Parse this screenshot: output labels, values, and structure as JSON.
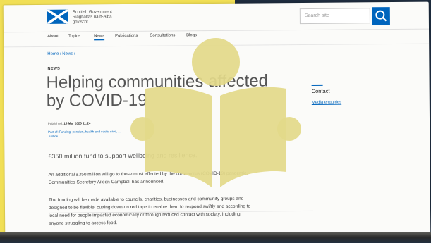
{
  "site": {
    "logo_lines": [
      "Scottish Government",
      "Riaghaltas na h-Alba",
      "gov.scot"
    ]
  },
  "search": {
    "placeholder": "Search site"
  },
  "nav": [
    {
      "label": "About",
      "active": false
    },
    {
      "label": "Topics",
      "active": false
    },
    {
      "label": "News",
      "active": true
    },
    {
      "label": "Publications",
      "active": false
    },
    {
      "label": "Consultations",
      "active": false
    },
    {
      "label": "Blogs",
      "active": false
    }
  ],
  "breadcrumb": "Home / News /",
  "article": {
    "label": "NEWS",
    "title": "Helping communities affected by COVID-19",
    "published_label": "Published:",
    "published": "18 Mar 2020 11:24",
    "part_of": "Part of: Funding, pension, health and social care, ...",
    "part_of_cont": "Justice",
    "summary": "£350 million fund to support wellbeing and resilience.",
    "paragraphs": [
      "An additional £350 million will go to those most affected by the coronavirus (COVID-19) pandemic, Communities Secretary Aileen Campbell has announced.",
      "The funding will be made available to councils, charities, businesses and community groups and designed to be flexible, cutting down on red tape to enable them to respond swiftly and according to local need for people impacted economically or through reduced contact with society, including anyone struggling to access food."
    ]
  },
  "sidebar": {
    "heading": "Contact",
    "link": "Media enquiries"
  },
  "colors": {
    "frame_yellow": "#f1df56",
    "frame_navy": "#1e2c3e",
    "accent_blue": "#0065bd",
    "reader_icon": "#e3d98a"
  },
  "icons": {
    "overlay": "reader-icon",
    "search": "search-icon",
    "flag": "saltire-flag-icon"
  }
}
